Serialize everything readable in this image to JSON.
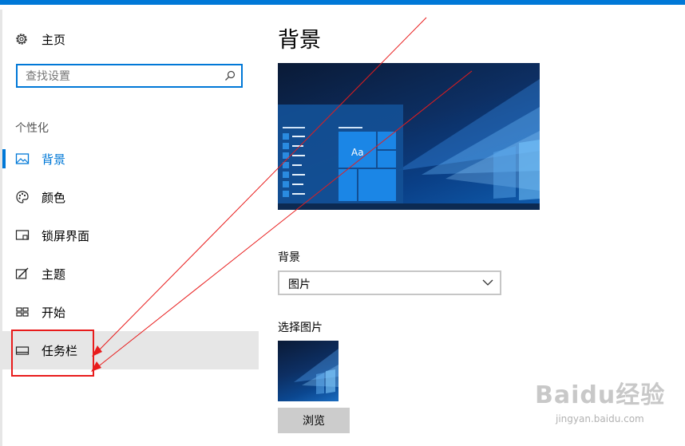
{
  "sidebar": {
    "home_label": "主页",
    "search_placeholder": "查找设置",
    "section_label": "个性化",
    "items": [
      {
        "label": "背景",
        "icon": "picture-icon",
        "active": true
      },
      {
        "label": "颜色",
        "icon": "palette-icon"
      },
      {
        "label": "锁屏界面",
        "icon": "lock-screen-icon"
      },
      {
        "label": "主题",
        "icon": "theme-brush-icon"
      },
      {
        "label": "开始",
        "icon": "start-tiles-icon"
      },
      {
        "label": "任务栏",
        "icon": "taskbar-icon",
        "hover": true
      }
    ]
  },
  "main": {
    "title": "背景",
    "preview_tile_text": "Aa",
    "background_label": "背景",
    "background_value": "图片",
    "choose_picture_label": "选择图片",
    "browse_label": "浏览"
  },
  "watermark": {
    "logo": "Baidu经验",
    "url": "jingyan.baidu.com"
  },
  "colors": {
    "accent": "#0078d7",
    "hover_bg": "#e6e6e6",
    "annotation_red": "#e81c1c",
    "button_gray": "#cccccc"
  }
}
